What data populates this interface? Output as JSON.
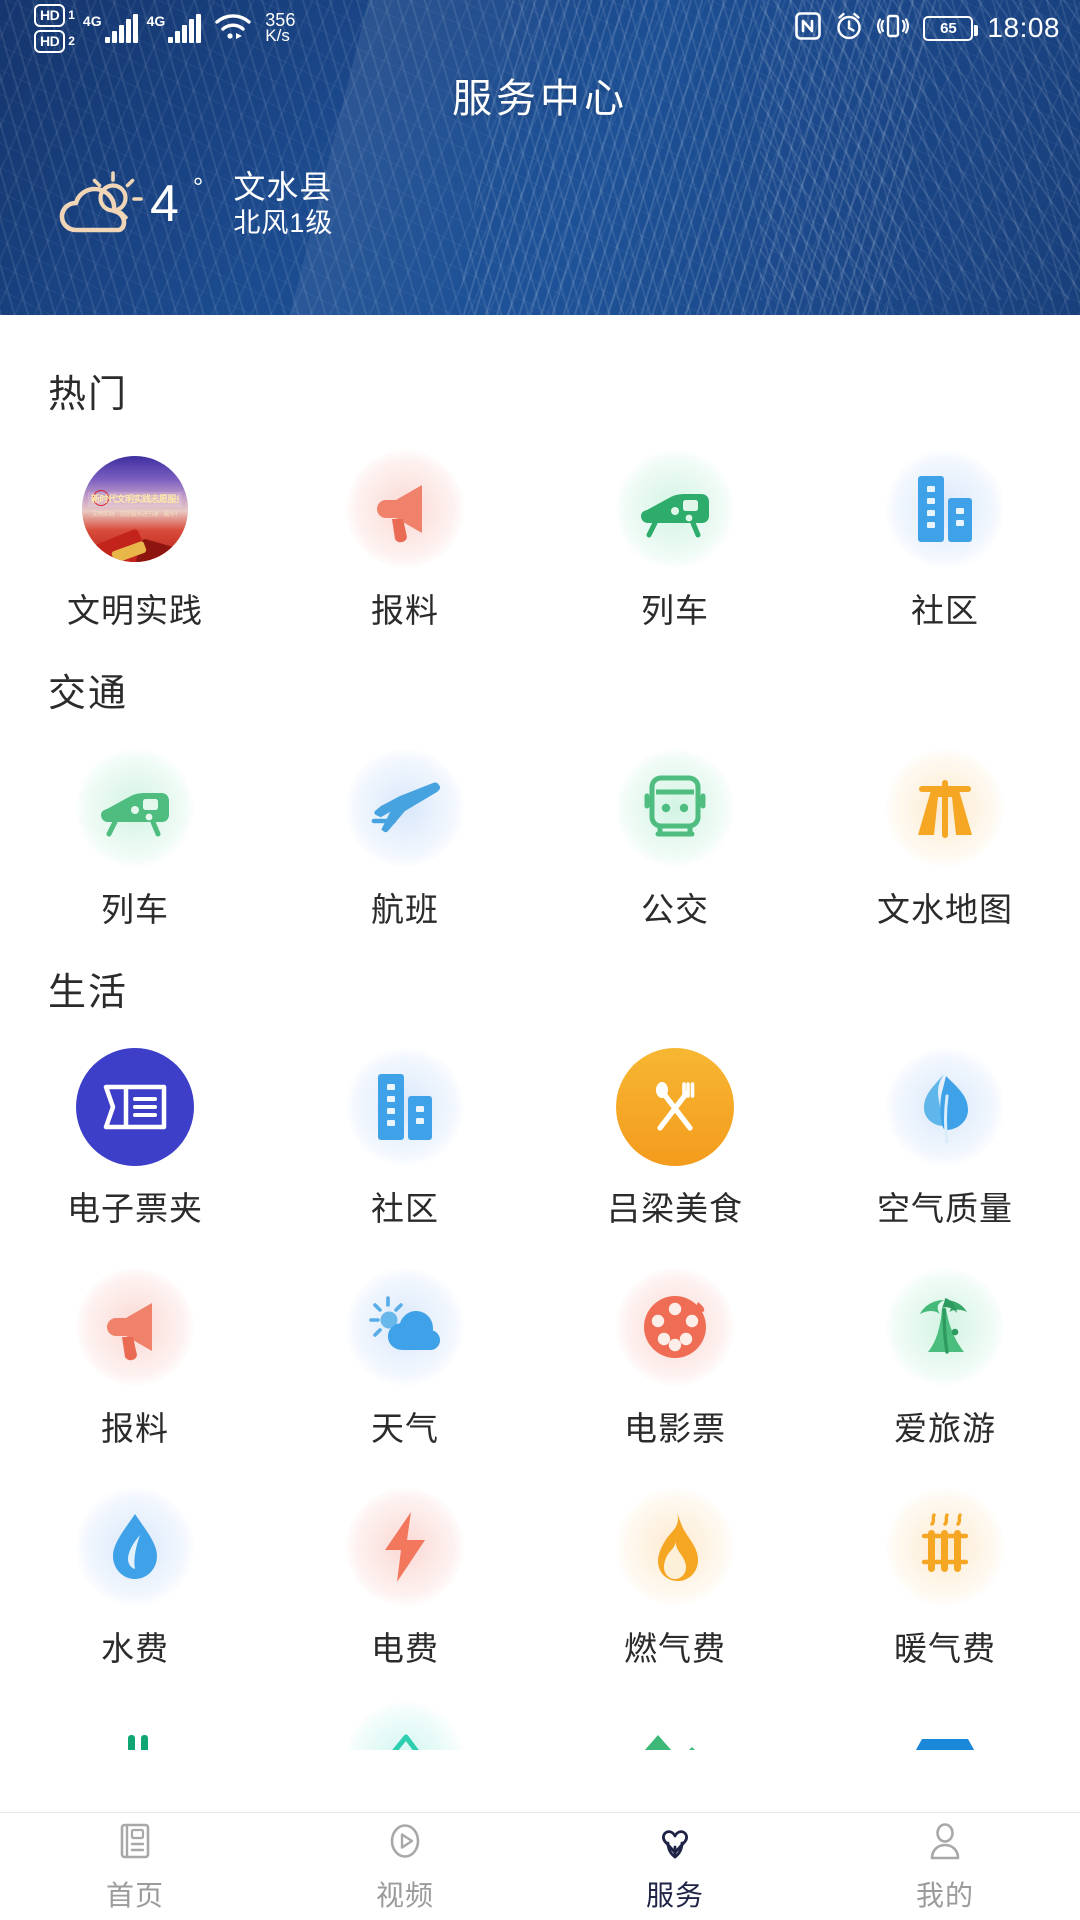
{
  "status_bar": {
    "hd1_label": "HD",
    "hd1_sub": "1",
    "hd2_label": "HD",
    "hd2_sub": "2",
    "sim1_network": "4G",
    "sim2_network": "4G",
    "net_speed_value": "356",
    "net_speed_unit": "K/s",
    "nfc_icon": "nfc-icon",
    "alarm_icon": "alarm-clock-icon",
    "vibrate_icon": "vibrate-icon",
    "battery_level": "65",
    "time": "18:08"
  },
  "header": {
    "title": "服务中心",
    "weather": {
      "icon": "partly-cloudy-icon",
      "temperature": "4",
      "degree_symbol": "°",
      "city": "文水县",
      "wind": "北风1级"
    }
  },
  "sections": [
    {
      "title": "热门",
      "items": [
        {
          "label": "文明实践",
          "icon": "civilization-practice-photo",
          "halo": "none",
          "banner_title": "新时代文明实践志愿服务",
          "banner_sub": "文明实践 · 志愿服务进万家 · 暖冬行动"
        },
        {
          "label": "报料",
          "icon": "megaphone-icon",
          "halo": "red"
        },
        {
          "label": "列车",
          "icon": "train-icon",
          "halo": "green"
        },
        {
          "label": "社区",
          "icon": "community-buildings-icon",
          "halo": "blue"
        }
      ]
    },
    {
      "title": "交通",
      "items": [
        {
          "label": "列车",
          "icon": "train-icon",
          "halo": "green"
        },
        {
          "label": "航班",
          "icon": "airplane-icon",
          "halo": "blue"
        },
        {
          "label": "公交",
          "icon": "bus-icon",
          "halo": "green"
        },
        {
          "label": "文水地图",
          "icon": "highway-map-icon",
          "halo": "orange"
        }
      ]
    },
    {
      "title": "生活",
      "items": [
        {
          "label": "电子票夹",
          "icon": "e-ticket-wallet-icon",
          "halo": "solid-blue"
        },
        {
          "label": "社区",
          "icon": "community-buildings-icon",
          "halo": "blue"
        },
        {
          "label": "吕梁美食",
          "icon": "food-cutlery-icon",
          "halo": "solid-orange"
        },
        {
          "label": "空气质量",
          "icon": "air-quality-leaf-icon",
          "halo": "blue"
        },
        {
          "label": "报料",
          "icon": "megaphone-icon",
          "halo": "red"
        },
        {
          "label": "天气",
          "icon": "weather-cloud-sun-icon",
          "halo": "blue"
        },
        {
          "label": "电影票",
          "icon": "film-reel-icon",
          "halo": "red"
        },
        {
          "label": "爱旅游",
          "icon": "palm-tree-icon",
          "halo": "green"
        },
        {
          "label": "水费",
          "icon": "water-drop-icon",
          "halo": "blue"
        },
        {
          "label": "电费",
          "icon": "lightning-bolt-icon",
          "halo": "red"
        },
        {
          "label": "燃气费",
          "icon": "gas-flame-icon",
          "halo": "orange"
        },
        {
          "label": "暖气费",
          "icon": "radiator-icon",
          "halo": "orange"
        }
      ],
      "clipped_row": [
        {
          "label": "",
          "icon": "broadcast-antenna-icon",
          "halo": "none"
        },
        {
          "label": "",
          "icon": "television-icon",
          "halo": "cyan"
        },
        {
          "label": "",
          "icon": "village-buildings-icon",
          "halo": "none"
        },
        {
          "label": "",
          "icon": "blue-stack-icon",
          "halo": "none"
        }
      ]
    }
  ],
  "tabbar": {
    "items": [
      {
        "label": "首页",
        "icon": "newspaper-icon",
        "active": false
      },
      {
        "label": "视频",
        "icon": "play-circle-icon",
        "active": false
      },
      {
        "label": "服务",
        "icon": "service-hands-heart-icon",
        "active": true
      },
      {
        "label": "我的",
        "icon": "person-icon",
        "active": false
      }
    ]
  },
  "colors": {
    "header_blue": "#1d4f93",
    "accent_green": "#3cb878",
    "accent_blue": "#3fa2e8",
    "accent_orange": "#f5a623",
    "accent_red": "#f0705a",
    "active_tab": "#1f2447"
  }
}
